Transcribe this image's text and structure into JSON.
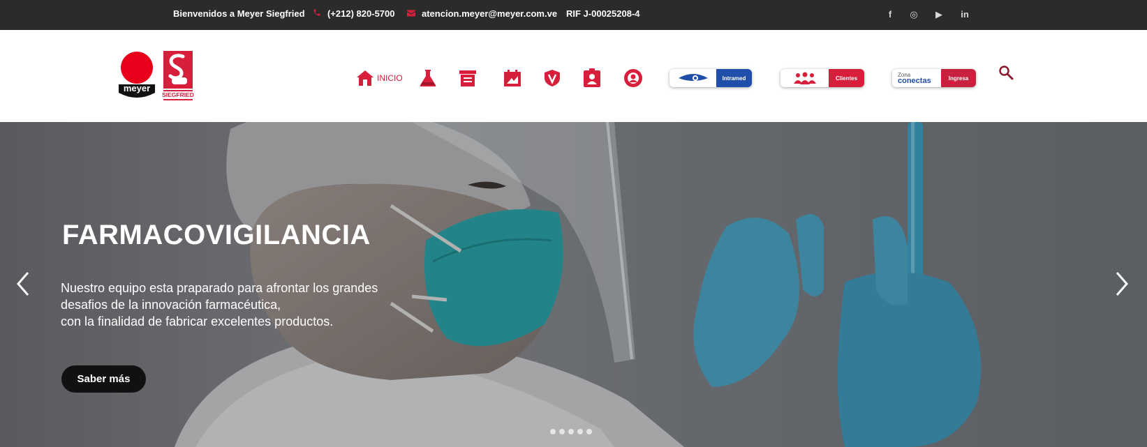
{
  "topbar": {
    "welcome": "Bienvenidos a Meyer Siegfried",
    "phone": "(+212) 820-5700",
    "email": "atencion.meyer@meyer.com.ve",
    "rif": "RIF J-00025208-4",
    "icons": {
      "phone": "phone-icon",
      "email": "envelope-icon"
    },
    "social": [
      {
        "icon": "facebook-icon",
        "glyph": "f"
      },
      {
        "icon": "instagram-icon",
        "glyph": "◎"
      },
      {
        "icon": "youtube-icon",
        "glyph": "▶"
      },
      {
        "icon": "linkedin-icon",
        "glyph": "in"
      }
    ]
  },
  "brand": {
    "meyer_logo_text": "meyer",
    "siegfried_logo_text": "SIEGFRIED",
    "accent": "#d71f3b",
    "dark": "#2b2b2b"
  },
  "nav": {
    "home_label": "INICIO",
    "icons": [
      "home-icon",
      "flask-icon",
      "archive-icon",
      "calendar-icon",
      "badge-v-icon",
      "id-card-icon",
      "support-icon"
    ]
  },
  "portals": {
    "intramed": {
      "logo": "eye-logo-icon",
      "label": "Intramed",
      "color": "#1f4fa8"
    },
    "clientes": {
      "logo": "group-people-icon",
      "label": "Clientes",
      "color": "#d71f3b"
    },
    "zona": {
      "logo_line1": "Zona",
      "logo_line2": "conectas",
      "label": "Ingresa",
      "color": "#c8203e"
    }
  },
  "hero": {
    "title": "FARMACOVIGILANCIA",
    "lines": [
      "Nuestro equipo esta praparado para afrontar los grandes",
      "desafios de la innovación farmacéutica,",
      "con la finalidad de fabricar excelentes productos."
    ],
    "button_label": "Saber más",
    "slides_count": 5
  }
}
